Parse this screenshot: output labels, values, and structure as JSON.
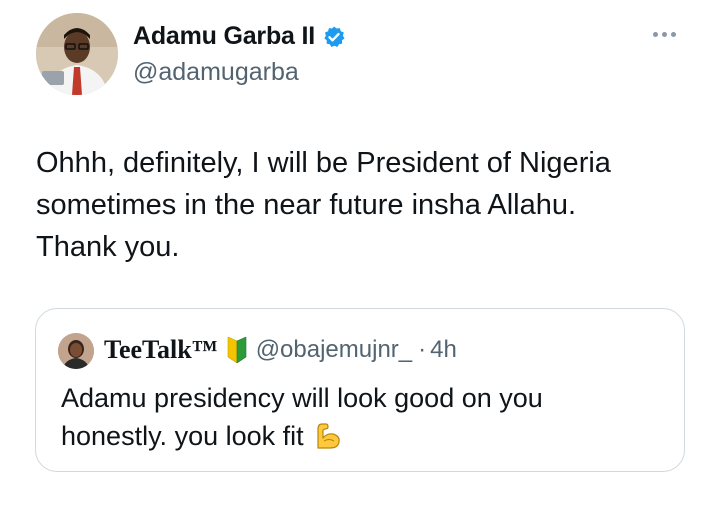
{
  "author": {
    "name": "Adamu Garba II",
    "handle": "@adamugarba",
    "verified": true,
    "avatar_icon": "profile-photo"
  },
  "tweet": {
    "text_lines": [
      "Ohhh, definitely, I will be President of Nigeria",
      "sometimes in the near future insha Allahu.",
      "Thank you."
    ]
  },
  "quoted_tweet": {
    "name": "TeeTalk™",
    "badge_icon": "japanese-beginner-symbol-icon",
    "handle": "@obajemujnr_",
    "separator": "·",
    "time": "4h",
    "text_line1": "Adamu presidency will look good on you",
    "text_line2": "honestly. you look fit",
    "emoji_icon": "flexed-biceps-icon"
  },
  "colors": {
    "text_primary": "#0f1419",
    "text_secondary": "#536471",
    "verified_blue": "#1d9bf0",
    "border": "#cfd9de"
  }
}
